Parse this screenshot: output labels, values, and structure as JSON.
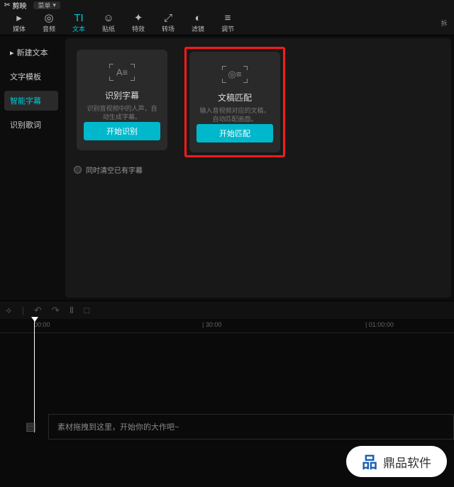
{
  "topbar": {
    "app_name": "剪映",
    "menu_label": "菜单"
  },
  "tabs": [
    {
      "label": "媒体",
      "icon": "▸"
    },
    {
      "label": "音频",
      "icon": "◎"
    },
    {
      "label": "文本",
      "icon": "TI"
    },
    {
      "label": "贴纸",
      "icon": "☺"
    },
    {
      "label": "特效",
      "icon": "✦"
    },
    {
      "label": "转场",
      "icon": "⤢"
    },
    {
      "label": "滤镜",
      "icon": "◐"
    },
    {
      "label": "调节",
      "icon": "≡"
    }
  ],
  "sidebar": [
    {
      "label": "新建文本",
      "prefix": "▸"
    },
    {
      "label": "文字模板",
      "prefix": ""
    },
    {
      "label": "智能字幕",
      "prefix": ""
    },
    {
      "label": "识别歌词",
      "prefix": ""
    }
  ],
  "cards": {
    "recognize": {
      "title": "识别字幕",
      "desc": "识别音视频中的人声，自动生成字幕。",
      "btn": "开始识别",
      "icon_text": "A≡"
    },
    "match": {
      "title": "文稿匹配",
      "desc": "输入音视频对应的文稿，自动匹配画面。",
      "btn": "开始匹配",
      "icon_text": "◎≡"
    }
  },
  "checkbox_label": "同时清空已有字幕",
  "timeline": {
    "start": "00:00",
    "ticks": [
      {
        "label": "| 30:00",
        "pos": 285
      },
      {
        "label": "| 01:00:00",
        "pos": 515
      }
    ],
    "track_hint": "素材拖拽到这里，开始你的大作吧~"
  },
  "watermark": "鼎品软件",
  "right_tab": "拆"
}
